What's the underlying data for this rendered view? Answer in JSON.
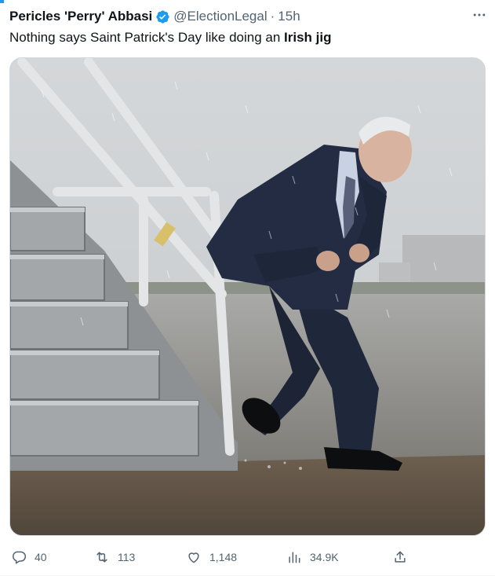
{
  "tweet": {
    "author_name": "Pericles 'Perry' Abbasi",
    "handle": "@ElectionLegal",
    "separator": "·",
    "time": "15h",
    "text_prefix": "Nothing says Saint Patrick's Day like doing an ",
    "text_bold": "Irish jig"
  },
  "media": {
    "alt": "Photo"
  },
  "actions": {
    "replies": "40",
    "retweets": "113",
    "likes": "1,148",
    "views": "34.9K"
  },
  "icons": {
    "verified": "verified-badge-icon",
    "more": "more-icon",
    "reply": "reply-icon",
    "retweet": "retweet-icon",
    "like": "heart-icon",
    "views": "views-icon",
    "share": "share-icon"
  },
  "colors": {
    "accent": "#1d9bf0",
    "text": "#0f1419",
    "muted": "#536471"
  }
}
